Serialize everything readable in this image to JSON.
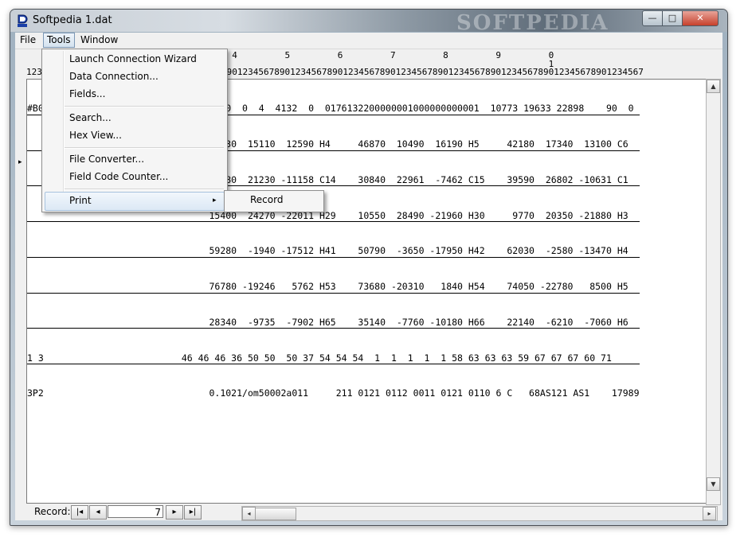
{
  "window": {
    "title": "Softpedia 1.dat",
    "watermark": "SOFTPEDIA",
    "controls": {
      "minimize": "—",
      "maximize": "□",
      "close": "✕"
    }
  },
  "menubar": {
    "file": "File",
    "tools": "Tools",
    "window": "Window"
  },
  "tools_menu": {
    "items": [
      "Launch Connection Wizard",
      "Data Connection...",
      "Fields...",
      "Search...",
      "Hex View...",
      "File Converter...",
      "Field Code Counter...",
      "Print"
    ],
    "submenu_arrow": "▸",
    "print_submenu": [
      "Record"
    ]
  },
  "ruler": {
    "tens": "                                       4         5         6         7         8         9         0",
    "tens_hundreds": "                                                                                                   1",
    "units": "123456789012345678901234567890123456789012345678901234567890123456789012345678901234567890123456789012345678901234567"
  },
  "data_lines": [
    "#B0                              4  0  0  4  4132  0  0176132200000001000000000001  10773 19633 22898    90  0",
    "                                 56430  15110  12590 H4     46870  10490  16190 H5     42180  17340  13100 C6",
    "                                 21180  21230 -11158 C14    30840  22961  -7462 C15    39590  26802 -10631 C1",
    "                                 15400  24270 -22011 H29    10550  28490 -21960 H30     9770  20350 -21880 H3",
    "                                 59280  -1940 -17512 H41    50790  -3650 -17950 H42    62030  -2580 -13470 H4",
    "                                 76780 -19246   5762 H53    73680 -20310   1840 H54    74050 -22780   8500 H5",
    "                                 28340  -9735  -7902 H65    35140  -7760 -10180 H66    22140  -6210  -7060 H6",
    "1 3                         46 46 46 36 50 50  50 37 54 54 54  1  1  1  1  1 58 63 63 63 59 67 67 67 60 71",
    "3P2                              0.1021/om50002a011     211 0121 0112 0011 0121 0110 6 C   68AS121 AS1    17989"
  ],
  "row_marker": "▸",
  "status": {
    "record_label": "Record:",
    "first": "|◂",
    "prev": "◂",
    "record_value": "7",
    "next": "▸",
    "last": "▸|"
  },
  "scroll": {
    "up": "▲",
    "down": "▼",
    "left": "◂",
    "right": "▸"
  }
}
